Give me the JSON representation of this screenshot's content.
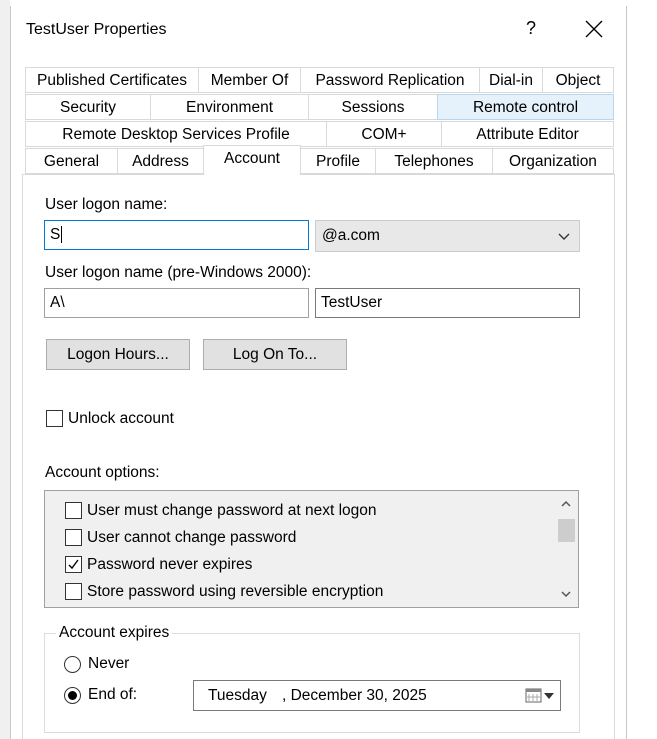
{
  "window": {
    "title": "TestUser Properties",
    "help": "?"
  },
  "tabs": {
    "row1": [
      "Published Certificates",
      "Member Of",
      "Password Replication",
      "Dial-in",
      "Object"
    ],
    "row2": [
      "Security",
      "Environment",
      "Sessions",
      "Remote control"
    ],
    "row3": [
      "Remote Desktop Services Profile",
      "COM+",
      "Attribute Editor"
    ],
    "row4": [
      "General",
      "Address",
      "Account",
      "Profile",
      "Telephones",
      "Organization"
    ]
  },
  "account": {
    "logon_label": "User logon name:",
    "logon_value": "S",
    "domain_suffix": "@a.com",
    "pre2000_label": "User logon name (pre-Windows 2000):",
    "pre2000_domain": "A\\",
    "pre2000_user": "TestUser",
    "logon_hours_button": "Logon Hours...",
    "log_on_to_button": "Log On To...",
    "unlock_label": "Unlock account",
    "options_label": "Account options:",
    "options": [
      {
        "label": "User must change password at next logon",
        "checked": false
      },
      {
        "label": "User cannot change password",
        "checked": false
      },
      {
        "label": "Password never expires",
        "checked": true
      },
      {
        "label": "Store password using reversible encryption",
        "checked": false
      }
    ],
    "expires": {
      "title": "Account expires",
      "never_label": "Never",
      "endof_label": "End of:",
      "day": "Tuesday",
      "date": ", December 30, 2025"
    }
  }
}
